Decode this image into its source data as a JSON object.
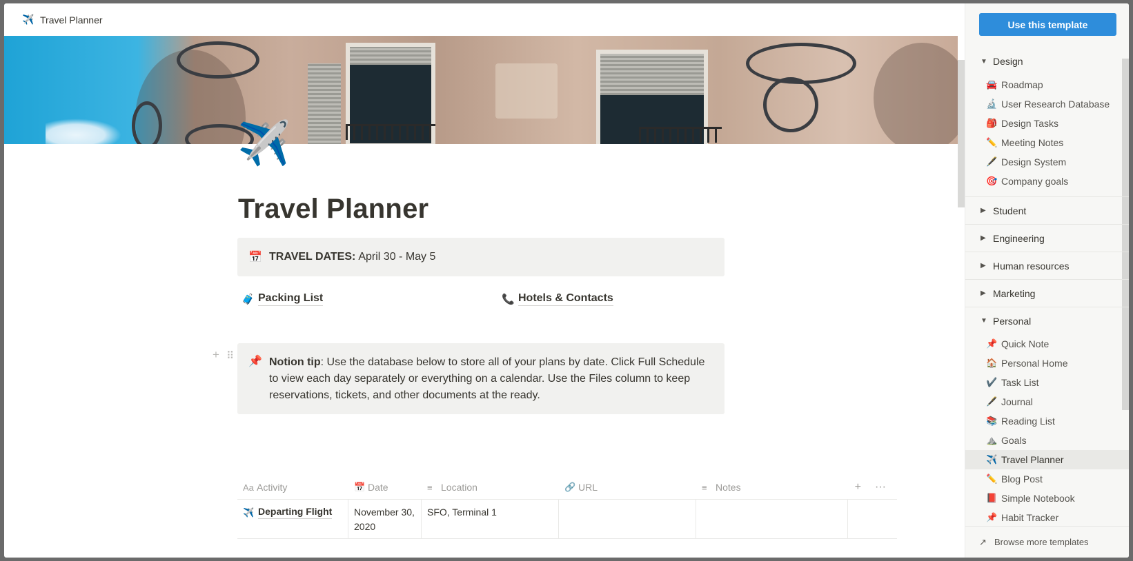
{
  "topbar": {
    "icon": "✈️",
    "title": "Travel Planner"
  },
  "page": {
    "icon": "✈️",
    "title": "Travel Planner",
    "dates_callout": {
      "icon": "📅",
      "label": "TRAVEL DATES:",
      "value": "April 30 - May 5"
    },
    "links": [
      {
        "icon": "🧳",
        "label": "Packing List"
      },
      {
        "icon": "📞",
        "label": "Hotels & Contacts"
      }
    ],
    "tip_callout": {
      "icon": "📌",
      "label": "Notion tip",
      "text": ": Use the database below to store all of your plans by date. Click Full Schedule to view each day separately or everything on a calendar. Use the Files column to keep reservations, tickets, and other documents at the ready."
    },
    "handle_plus": "+",
    "handle_drag": "⠿",
    "table": {
      "columns": [
        {
          "icon": "Aa",
          "label": "Activity"
        },
        {
          "icon": "📅",
          "label": "Date"
        },
        {
          "icon": "≡",
          "label": "Location"
        },
        {
          "icon": "🔗",
          "label": "URL"
        },
        {
          "icon": "≡",
          "label": "Notes"
        }
      ],
      "add_label": "+",
      "more_label": "···",
      "rows": [
        {
          "icon": "✈️",
          "activity": "Departing Flight",
          "date": "November 30, 2020",
          "location": "SFO, Terminal 1",
          "url": "",
          "notes": ""
        }
      ]
    }
  },
  "sidebar": {
    "use_template_label": "Use this template",
    "categories": [
      {
        "label": "Design",
        "expanded": true,
        "items": [
          {
            "icon": "🚘",
            "label": "Roadmap"
          },
          {
            "icon": "🔬",
            "label": "User Research Database"
          },
          {
            "icon": "🎒",
            "label": "Design Tasks"
          },
          {
            "icon": "✏️",
            "label": "Meeting Notes"
          },
          {
            "icon": "🖋️",
            "label": "Design System"
          },
          {
            "icon": "🎯",
            "label": "Company goals"
          }
        ]
      },
      {
        "label": "Student",
        "expanded": false,
        "items": []
      },
      {
        "label": "Engineering",
        "expanded": false,
        "items": []
      },
      {
        "label": "Human resources",
        "expanded": false,
        "items": []
      },
      {
        "label": "Marketing",
        "expanded": false,
        "items": []
      },
      {
        "label": "Personal",
        "expanded": true,
        "items": [
          {
            "icon": "📌",
            "label": "Quick Note"
          },
          {
            "icon": "🏠",
            "label": "Personal Home"
          },
          {
            "icon": "✔️",
            "label": "Task List"
          },
          {
            "icon": "🖋️",
            "label": "Journal"
          },
          {
            "icon": "📚",
            "label": "Reading List"
          },
          {
            "icon": "⛰️",
            "label": "Goals"
          },
          {
            "icon": "✈️",
            "label": "Travel Planner",
            "active": true
          },
          {
            "icon": "✏️",
            "label": "Blog Post"
          },
          {
            "icon": "📕",
            "label": "Simple Notebook"
          },
          {
            "icon": "📌",
            "label": "Habit Tracker"
          }
        ]
      }
    ],
    "footer": {
      "icon": "↗",
      "label": "Browse more templates"
    }
  },
  "colors": {
    "accent": "#2e8ddb",
    "callout_bg": "#f1f1ef",
    "sidebar_bg": "#f7f7f5",
    "text": "#37352f"
  }
}
